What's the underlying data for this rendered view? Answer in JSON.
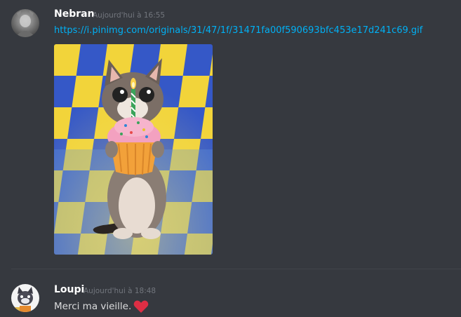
{
  "messages": [
    {
      "username": "Nebran",
      "timestamp": "Aujourd'hui à 16:55",
      "text": "https://i.pinimg.com/originals/31/47/1f/31471fa00f590693bfc453e17d241c69.gif",
      "attachment": "birthday-cat-cupcake-gif"
    },
    {
      "username": "Loupi",
      "timestamp": "Aujourd'hui à 18:48",
      "text": "Merci ma vieille.",
      "emoji": "red-heart"
    }
  ],
  "colors": {
    "background": "#36393f",
    "username": "#ffffff",
    "timestamp": "#72767d",
    "text": "#dcddde",
    "link": "#00b0f4",
    "heart": "#dd2e44"
  }
}
